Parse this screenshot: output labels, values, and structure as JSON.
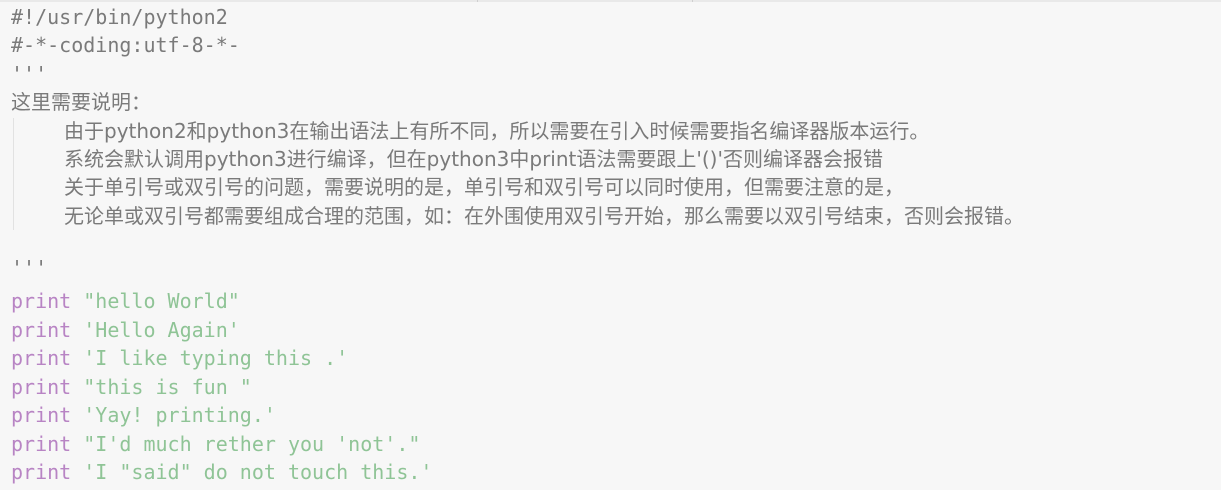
{
  "code": {
    "shebang": "#!/usr/bin/python2",
    "coding": "#-*-coding:utf-8-*-",
    "doc_open": "'''",
    "doc_heading": "这里需要说明：",
    "doc_lines": [
      "由于python2和python3在输出语法上有所不同，所以需要在引入时候需要指名编译器版本运行。",
      "系统会默认调用python3进行编译，但在python3中print语法需要跟上'()'否则编译器会报错",
      "关于单引号或双引号的问题，需要说明的是，单引号和双引号可以同时使用，但需要注意的是，",
      "无论单或双引号都需要组成合理的范围，如：在外围使用双引号开始，那么需要以双引号结束，否则会报错。"
    ],
    "doc_close": "'''",
    "print_statements": [
      {
        "keyword": "print",
        "string": "\"hello World\""
      },
      {
        "keyword": "print",
        "string": "'Hello Again'"
      },
      {
        "keyword": "print",
        "string": "'I like typing this .'"
      },
      {
        "keyword": "print",
        "string": "\"this is fun \""
      },
      {
        "keyword": "print",
        "string": "'Yay! printing.'"
      },
      {
        "keyword": "print",
        "string": "\"I'd much rether you 'not'.\""
      },
      {
        "keyword": "print",
        "string": "'I \"said\" do not touch this.'"
      }
    ]
  },
  "colors": {
    "background": "#f7f7f7",
    "comment": "#7a7a7a",
    "keyword": "#b884c4",
    "string": "#8fc496"
  }
}
